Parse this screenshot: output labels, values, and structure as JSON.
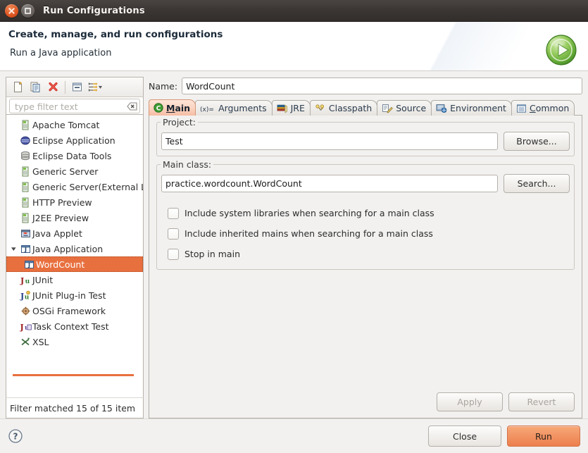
{
  "window": {
    "title": "Run Configurations",
    "close_icon": "close-icon",
    "maximize_icon": "maximize-icon"
  },
  "banner": {
    "title": "Create, manage, and run configurations",
    "subtitle": "Run a Java application",
    "icon": "run-launch-icon",
    "accent_green": "#5aa832"
  },
  "toolbar": {
    "buttons": [
      {
        "name": "new-configuration-icon",
        "tip": "New launch configuration"
      },
      {
        "name": "duplicate-configuration-icon",
        "tip": "Duplicate currently selected launch configuration"
      },
      {
        "name": "delete-configuration-icon",
        "tip": "Delete selected launch configuration(s)"
      },
      {
        "name": "collapse-all-icon",
        "tip": "Collapse All"
      },
      {
        "name": "filter-configurations-icon",
        "tip": "Filter launch configurations"
      }
    ]
  },
  "filter": {
    "placeholder": "type filter text",
    "value": "",
    "clear_icon": "clear-icon",
    "status": "Filter matched 15 of 15 item"
  },
  "tree": {
    "items": [
      {
        "label": "Apache Tomcat",
        "icon": "server-icon",
        "indent": 0,
        "expandable": false,
        "selected": false
      },
      {
        "label": "Eclipse Application",
        "icon": "eclipse-sphere-icon",
        "indent": 0,
        "expandable": false,
        "selected": false
      },
      {
        "label": "Eclipse Data Tools",
        "icon": "database-icon",
        "indent": 0,
        "expandable": false,
        "selected": false
      },
      {
        "label": "Generic Server",
        "icon": "server-icon",
        "indent": 0,
        "expandable": false,
        "selected": false
      },
      {
        "label": "Generic Server(External Launch)",
        "icon": "server-icon",
        "indent": 0,
        "expandable": false,
        "selected": false
      },
      {
        "label": "HTTP Preview",
        "icon": "server-icon",
        "indent": 0,
        "expandable": false,
        "selected": false
      },
      {
        "label": "J2EE Preview",
        "icon": "server-icon",
        "indent": 0,
        "expandable": false,
        "selected": false
      },
      {
        "label": "Java Applet",
        "icon": "java-applet-icon",
        "indent": 0,
        "expandable": false,
        "selected": false
      },
      {
        "label": "Java Application",
        "icon": "java-application-icon",
        "indent": 0,
        "expandable": true,
        "expanded": true,
        "selected": false
      },
      {
        "label": "WordCount",
        "icon": "java-application-icon",
        "indent": 1,
        "expandable": false,
        "selected": true
      },
      {
        "label": "JUnit",
        "icon": "junit-icon",
        "indent": 0,
        "expandable": false,
        "selected": false
      },
      {
        "label": "JUnit Plug-in Test",
        "icon": "junit-plugin-icon",
        "indent": 0,
        "expandable": false,
        "selected": false
      },
      {
        "label": "OSGi Framework",
        "icon": "osgi-icon",
        "indent": 0,
        "expandable": false,
        "selected": false
      },
      {
        "label": "Task Context Test",
        "icon": "task-context-icon",
        "indent": 0,
        "expandable": false,
        "selected": false
      },
      {
        "label": "XSL",
        "icon": "xsl-icon",
        "indent": 0,
        "expandable": false,
        "selected": false
      }
    ],
    "selection_color": "#e8703f"
  },
  "form": {
    "name_label": "Name:",
    "name_value": "WordCount",
    "project": {
      "legend": "Project:",
      "value": "Test",
      "button": "Browse..."
    },
    "main_class": {
      "legend": "Main class:",
      "value": "practice.wordcount.WordCount",
      "button": "Search..."
    },
    "checkboxes": [
      {
        "label": "Include system libraries when searching for a main class",
        "checked": false
      },
      {
        "label": "Include inherited mains when searching for a main class",
        "checked": false
      },
      {
        "label": "Stop in main",
        "checked": false
      }
    ],
    "apply_label": "Apply",
    "apply_enabled": false,
    "revert_label": "Revert",
    "revert_enabled": false
  },
  "tabs": [
    {
      "label": "Main",
      "icon": "main-tab-icon",
      "active": true,
      "mnemonic": "M"
    },
    {
      "label": "Arguments",
      "icon": "arguments-tab-icon",
      "active": false
    },
    {
      "label": "JRE",
      "icon": "jre-tab-icon",
      "active": false
    },
    {
      "label": "Classpath",
      "icon": "classpath-tab-icon",
      "active": false
    },
    {
      "label": "Source",
      "icon": "source-tab-icon",
      "active": false
    },
    {
      "label": "Environment",
      "icon": "environment-tab-icon",
      "active": false
    },
    {
      "label": "Common",
      "icon": "common-tab-icon",
      "active": false,
      "mnemonic": "C"
    }
  ],
  "footer": {
    "help_icon": "help-icon",
    "close_label": "Close",
    "run_label": "Run",
    "run_is_default": true,
    "run_color": "#f0914f"
  }
}
